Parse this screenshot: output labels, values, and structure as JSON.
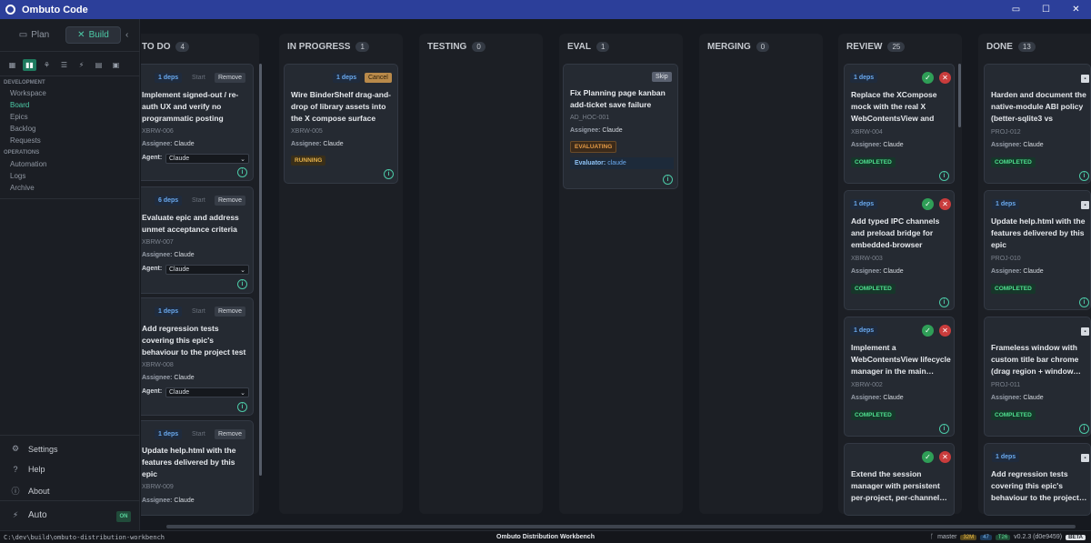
{
  "app": {
    "title": "Ombuto Code"
  },
  "window_controls": {
    "minimize": "▭",
    "maximize": "☐",
    "close": "✕"
  },
  "sidebar": {
    "modes": [
      {
        "label": "Plan",
        "icon": "▭"
      },
      {
        "label": "Build",
        "icon": "✕"
      }
    ],
    "collapse": "‹",
    "views": [
      "▦",
      "▮▮",
      "⚘",
      "☰",
      "⚡",
      "▤",
      "▣"
    ],
    "development_label": "DEVELOPMENT",
    "development": [
      "Workspace",
      "Board",
      "Epics",
      "Backlog",
      "Requests"
    ],
    "operations_label": "OPERATIONS",
    "operations": [
      "Automation",
      "Logs",
      "Archive"
    ],
    "bottom": [
      {
        "label": "Settings",
        "icon": "⚙"
      },
      {
        "label": "Help",
        "icon": "?"
      },
      {
        "label": "About",
        "icon": "ⓘ"
      }
    ],
    "auto": {
      "label": "Auto",
      "icon": "⚡",
      "state": "ON"
    }
  },
  "common": {
    "start": "Start",
    "remove": "Remove",
    "cancel": "Cancel",
    "skip": "Skip",
    "assignee_label": "Assignee:",
    "agent_label": "Agent:",
    "evaluator_label": "Evaluator:",
    "info": "i",
    "approve": "✓",
    "reject": "✕",
    "archive": "▪",
    "chevron": "⌄"
  },
  "columns": [
    {
      "name": "TO DO",
      "count": "4",
      "cards": [
        {
          "deps": "1 deps",
          "title": "Implement signed-out / re-auth UX and verify no programmatic posting path…",
          "id": "XBRW-006",
          "assignee": "Claude",
          "agent": "Claude"
        },
        {
          "deps": "6 deps",
          "title": "Evaluate epic and address unmet acceptance criteria",
          "id": "XBRW-007",
          "assignee": "Claude",
          "agent": "Claude"
        },
        {
          "deps": "1 deps",
          "title": "Add regression tests covering this epic's behaviour to the project test suite",
          "id": "XBRW-008",
          "assignee": "Claude",
          "agent": "Claude"
        },
        {
          "deps": "1 deps",
          "title": "Update help.html with the features delivered by this epic",
          "id": "XBRW-009",
          "assignee": "Claude"
        }
      ]
    },
    {
      "name": "IN PROGRESS",
      "count": "1",
      "cards": [
        {
          "deps": "1 deps",
          "title": "Wire BinderShelf drag-and-drop of library assets into the X compose surface",
          "id": "XBRW-005",
          "assignee": "Claude",
          "status": "RUNNING"
        }
      ]
    },
    {
      "name": "TESTING",
      "count": "0",
      "cards": []
    },
    {
      "name": "EVAL",
      "count": "1",
      "cards": [
        {
          "title": "Fix Planning page kanban add-ticket save failure",
          "id": "AD_HOC-001",
          "assignee": "Claude",
          "status": "EVALUATING",
          "evaluator": "claude"
        }
      ]
    },
    {
      "name": "MERGING",
      "count": "0",
      "cards": []
    },
    {
      "name": "REVIEW",
      "count": "25",
      "cards": [
        {
          "deps": "1 deps",
          "title": "Replace the XCompose mock with the real X WebContentsView and wir…",
          "id": "XBRW-004",
          "assignee": "Claude",
          "status": "COMPLETED"
        },
        {
          "deps": "1 deps",
          "title": "Add typed IPC channels and preload bridge for embedded-browser contr…",
          "id": "XBRW-003",
          "assignee": "Claude",
          "status": "COMPLETED"
        },
        {
          "deps": "1 deps",
          "title": "Implement a WebContentsView lifecycle manager in the main…",
          "id": "XBRW-002",
          "assignee": "Claude",
          "status": "COMPLETED"
        },
        {
          "title": "Extend the session manager with persistent per-project, per-channel…"
        }
      ]
    },
    {
      "name": "DONE",
      "count": "13",
      "cards": [
        {
          "title": "Harden and document the native-module ABI policy (better-sqlite3 vs Electron…",
          "id": "PROJ-012",
          "assignee": "Claude",
          "status": "COMPLETED"
        },
        {
          "deps": "1 deps",
          "title": "Update help.html with the features delivered by this epic",
          "id": "PROJ-010",
          "assignee": "Claude",
          "status": "COMPLETED"
        },
        {
          "title": "Frameless window with custom title bar chrome (drag region + window…",
          "id": "PROJ-011",
          "assignee": "Claude",
          "status": "COMPLETED"
        },
        {
          "deps": "1 deps",
          "title": "Add regression tests covering this epic's behaviour to the project…"
        }
      ]
    }
  ],
  "statusbar": {
    "path": "C:\\dev\\build\\ombuto-distribution-workbench",
    "center": "Ombuto Distribution Workbench",
    "branch_icon": "ᚴ",
    "branch": "master",
    "modified": "32M",
    "ahead": "47",
    "tests": "T26",
    "version": "v0.2.3 (d0e9459)",
    "beta": "BETA"
  }
}
